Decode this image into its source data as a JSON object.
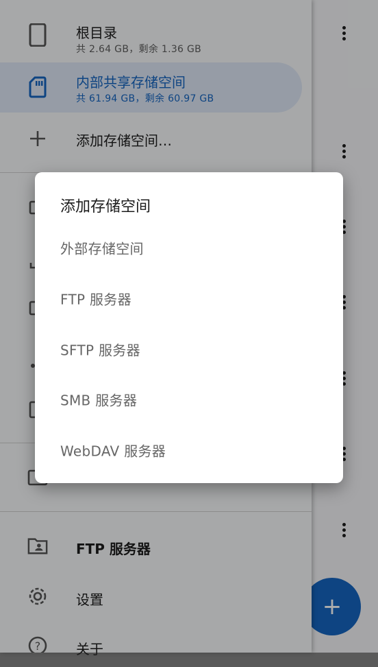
{
  "drawer": {
    "storage": [
      {
        "title": "根目录",
        "subtitle": "共 2.64 GB，剩余 1.36 GB",
        "icon": "phone-icon"
      },
      {
        "title": "内部共享存储空间",
        "subtitle": "共 61.94 GB，剩余 60.97 GB",
        "icon": "sd-card-icon",
        "selected": true
      }
    ],
    "add_storage_label": "添加存储空间…",
    "bottom": [
      {
        "label": "FTP 服务器",
        "icon": "folder-shared-icon"
      },
      {
        "label": "设置",
        "icon": "gear-icon"
      },
      {
        "label": "关于",
        "icon": "help-icon"
      }
    ]
  },
  "dialog": {
    "title": "添加存储空间",
    "options": [
      "外部存储空间",
      "FTP 服务器",
      "SFTP 服务器",
      "SMB 服务器",
      "WebDAV 服务器"
    ]
  },
  "fab": {
    "icon": "plus-icon",
    "glyph": "+"
  },
  "colors": {
    "accent": "#1565c0",
    "selected_bg": "#dde6f5",
    "selected_text": "#1565c0"
  }
}
